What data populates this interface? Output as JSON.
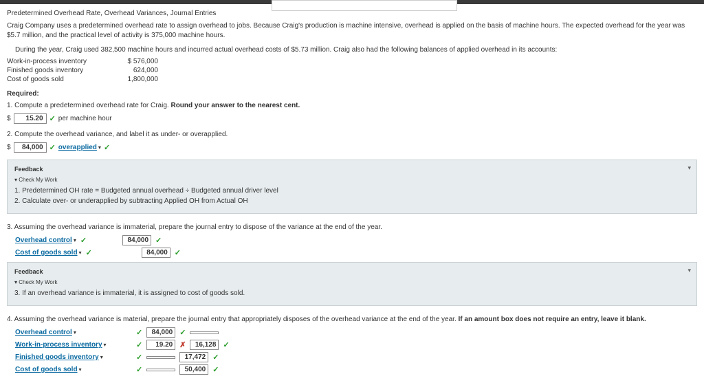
{
  "header": {
    "title": "Predetermined Overhead Rate, Overhead Variances, Journal Entries"
  },
  "intro": {
    "p1": "Craig Company uses a predetermined overhead rate to assign overhead to jobs. Because Craig's production is machine intensive, overhead is applied on the basis of machine hours. The expected overhead for the year was $5.7 million, and the practical level of activity is 375,000 machine hours.",
    "p2": "During the year, Craig used 382,500 machine hours and incurred actual overhead costs of $5.73 million. Craig also had the following balances of applied overhead in its accounts:"
  },
  "balances": {
    "wip_label": "Work-in-process inventory",
    "wip_amount": "$ 576,000",
    "fg_label": "Finished goods inventory",
    "fg_amount": "624,000",
    "cogs_label": "Cost of goods sold",
    "cogs_amount": "1,800,000"
  },
  "required": "Required:",
  "q1": {
    "text_a": "1. Compute a predetermined overhead rate for Craig. ",
    "text_b": "Round your answer to the nearest cent.",
    "answer": "15.20",
    "unit": "per machine hour"
  },
  "q2": {
    "text": "2. Compute the overhead variance, and label it as under- or overapplied.",
    "answer": "84,000",
    "label": "overapplied"
  },
  "fb1": {
    "title": "Feedback",
    "cmw": "▾ Check My Work",
    "l1": "1. Predetermined OH rate = Budgeted annual overhead ÷ Budgeted annual driver level",
    "l2": "2. Calculate over- or underapplied by subtracting Applied OH from Actual OH"
  },
  "q3": {
    "text": "3. Assuming the overhead variance is immaterial, prepare the journal entry to dispose of the variance at the end of the year.",
    "acc1": "Overhead control",
    "amt1": "84,000",
    "acc2": "Cost of goods sold",
    "amt2": "84,000"
  },
  "fb2": {
    "title": "Feedback",
    "cmw": "▾ Check My Work",
    "l1": "3. If an overhead variance is immaterial, it is assigned to cost of goods sold."
  },
  "q4": {
    "text_a": "4. Assuming the overhead variance is material, prepare the journal entry that appropriately disposes of the overhead variance at the end of the year. ",
    "text_b": "If an amount box does not require an entry, leave it blank.",
    "r1_acc": "Overhead control",
    "r1_d": "84,000",
    "r1_c": "",
    "r2_acc": "Work-in-process inventory",
    "r2_d": "19.20",
    "r2_c": "16,128",
    "r3_acc": "Finished goods inventory",
    "r3_d": "",
    "r3_c": "17,472",
    "r4_acc": "Cost of goods sold",
    "r4_d": "",
    "r4_c": "50,400"
  }
}
